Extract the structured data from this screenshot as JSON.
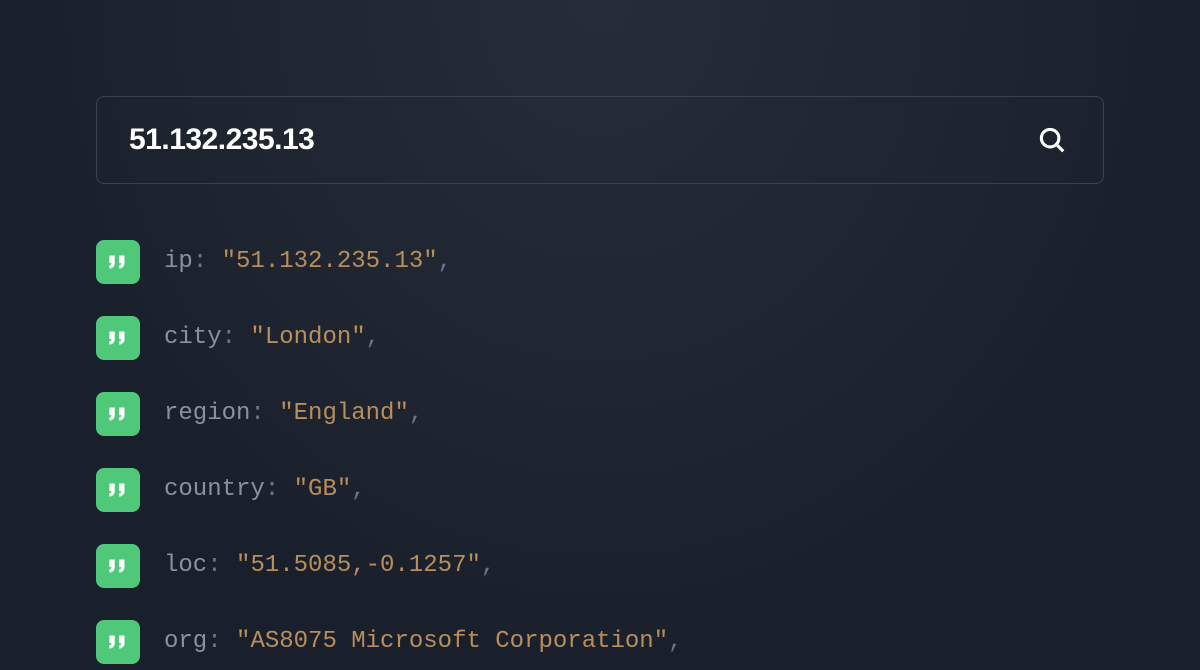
{
  "search": {
    "value": "51.132.235.13",
    "placeholder": ""
  },
  "colors": {
    "badge": "#4fc879",
    "key": "#8691a3",
    "value": "#b88e5a"
  },
  "fields": [
    {
      "key": "ip",
      "value": "51.132.235.13"
    },
    {
      "key": "city",
      "value": "London"
    },
    {
      "key": "region",
      "value": "England"
    },
    {
      "key": "country",
      "value": "GB"
    },
    {
      "key": "loc",
      "value": "51.5085,-0.1257"
    },
    {
      "key": "org",
      "value": "AS8075 Microsoft Corporation"
    }
  ]
}
